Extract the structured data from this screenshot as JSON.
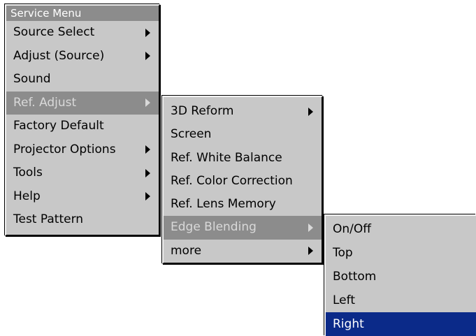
{
  "service_menu": {
    "title": "Service Menu",
    "items": [
      {
        "label": "Source Select",
        "submenu": true
      },
      {
        "label": "Adjust (Source)",
        "submenu": true
      },
      {
        "label": "Sound",
        "submenu": false
      },
      {
        "label": "Ref. Adjust",
        "submenu": true,
        "state": "highlighted"
      },
      {
        "label": "Factory Default",
        "submenu": false
      },
      {
        "label": "Projector Options",
        "submenu": true
      },
      {
        "label": "Tools",
        "submenu": true
      },
      {
        "label": "Help",
        "submenu": true
      },
      {
        "label": "Test Pattern",
        "submenu": false
      }
    ]
  },
  "ref_adjust_menu": {
    "items": [
      {
        "label": "3D Reform",
        "submenu": true
      },
      {
        "label": "Screen",
        "submenu": false
      },
      {
        "label": "Ref. White Balance",
        "submenu": false
      },
      {
        "label": "Ref. Color Correction",
        "submenu": false
      },
      {
        "label": "Ref. Lens Memory",
        "submenu": false
      },
      {
        "label": "Edge Blending",
        "submenu": true,
        "state": "highlighted"
      },
      {
        "label": "more",
        "submenu": true
      }
    ]
  },
  "edge_blending_menu": {
    "items": [
      {
        "label": "On/Off"
      },
      {
        "label": "Top"
      },
      {
        "label": "Bottom"
      },
      {
        "label": "Left"
      },
      {
        "label": "Right",
        "state": "selected"
      }
    ]
  },
  "colors": {
    "menu_background": "#c8c8c8",
    "highlight_gray": "#8c8c8c",
    "selected_blue": "#0b2a89"
  },
  "icons": {
    "submenu_indicator": "triangle-right-icon"
  }
}
